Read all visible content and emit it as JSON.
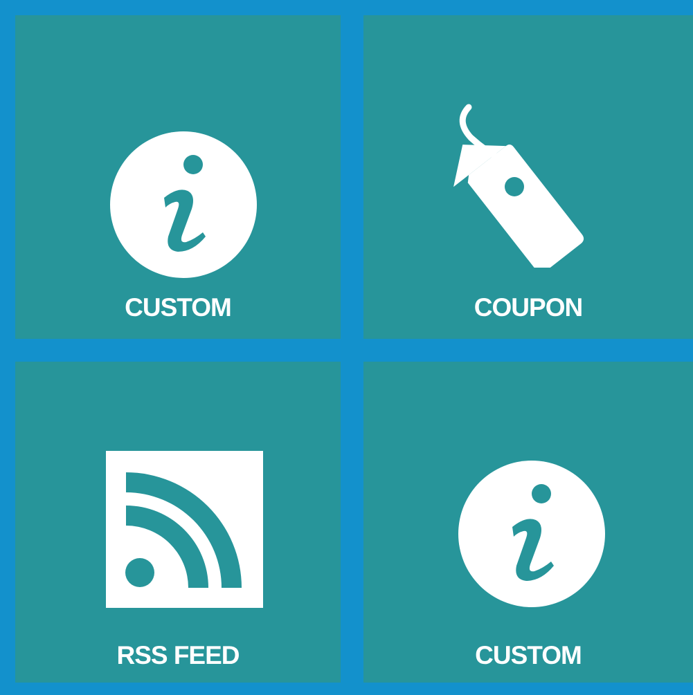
{
  "colors": {
    "background": "#1391cc",
    "tile": "#27959a",
    "foreground": "#ffffff"
  },
  "tiles": [
    {
      "label": "CUSTOM",
      "icon": "info-icon"
    },
    {
      "label": "COUPON",
      "icon": "tag-icon"
    },
    {
      "label": "RSS FEED",
      "icon": "rss-icon"
    },
    {
      "label": "CUSTOM",
      "icon": "info-icon"
    }
  ]
}
